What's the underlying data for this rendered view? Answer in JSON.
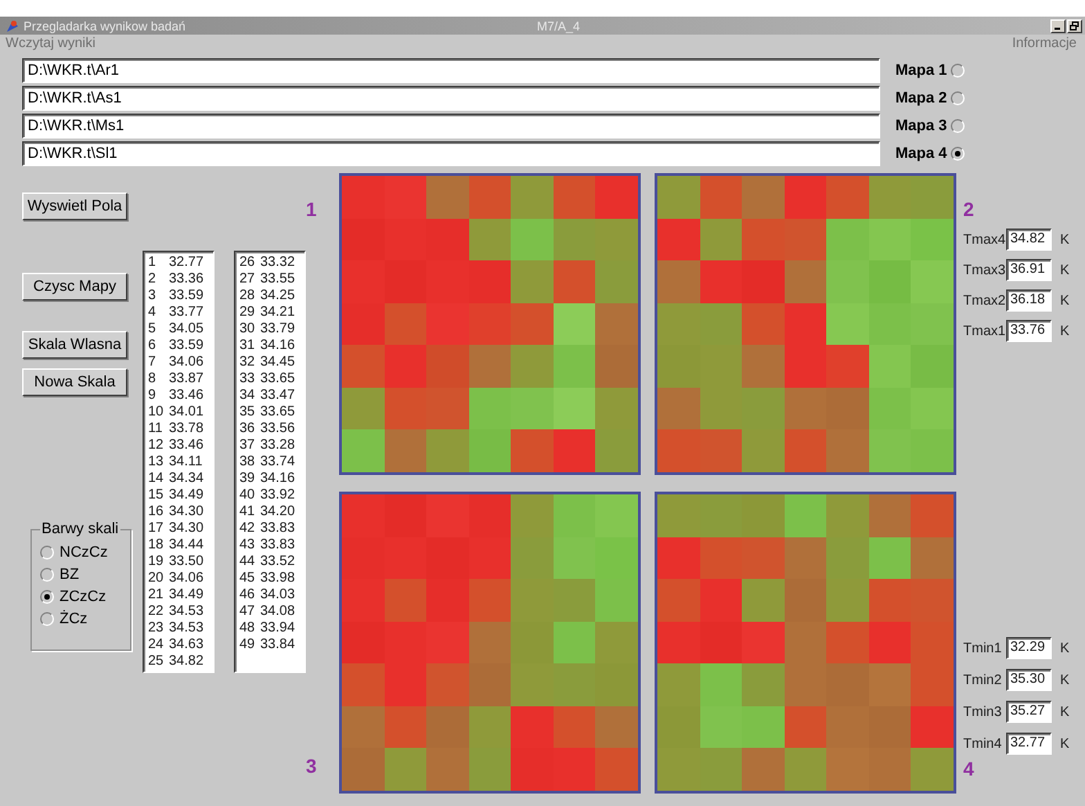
{
  "window": {
    "title": "Przegladarka wynikow badań",
    "subtitle": "M7/A_4"
  },
  "menu": [
    {
      "label": "Wczytaj wyniki",
      "disabled": true
    },
    {
      "label": "Informacje",
      "disabled": true
    }
  ],
  "files": [
    {
      "path": "D:\\WKR.t\\Ar1",
      "map_label": "Mapa 1",
      "selected": false
    },
    {
      "path": "D:\\WKR.t\\As1",
      "map_label": "Mapa 2",
      "selected": false
    },
    {
      "path": "D:\\WKR.t\\Ms1",
      "map_label": "Mapa 3",
      "selected": false
    },
    {
      "path": "D:\\WKR.t\\Sl1",
      "map_label": "Mapa 4",
      "selected": true
    }
  ],
  "buttons": [
    "Wyswietl Pola",
    "Czysc Mapy",
    "Skala Wlasna",
    "Nowa Skala"
  ],
  "color_scale": {
    "title": "Barwy skali",
    "options": [
      {
        "label": "NCzCz",
        "selected": false
      },
      {
        "label": "BZ",
        "selected": false
      },
      {
        "label": "ZCzCz",
        "selected": true
      },
      {
        "label": "ŻCz",
        "selected": false
      }
    ]
  },
  "value_lists": [
    [
      {
        "index": "1",
        "value": "32.77"
      },
      {
        "index": "2",
        "value": "33.36"
      },
      {
        "index": "3",
        "value": "33.59"
      },
      {
        "index": "4",
        "value": "33.77"
      },
      {
        "index": "5",
        "value": "34.05"
      },
      {
        "index": "6",
        "value": "33.59"
      },
      {
        "index": "7",
        "value": "34.06"
      },
      {
        "index": "8",
        "value": "33.87"
      },
      {
        "index": "9",
        "value": "33.46"
      },
      {
        "index": "10",
        "value": "34.01"
      },
      {
        "index": "11",
        "value": "33.78"
      },
      {
        "index": "12",
        "value": "33.46"
      },
      {
        "index": "13",
        "value": "34.11"
      },
      {
        "index": "14",
        "value": "34.34"
      },
      {
        "index": "15",
        "value": "34.49"
      },
      {
        "index": "16",
        "value": "34.30"
      },
      {
        "index": "17",
        "value": "34.30"
      },
      {
        "index": "18",
        "value": "34.44"
      },
      {
        "index": "19",
        "value": "33.50"
      },
      {
        "index": "20",
        "value": "34.06"
      },
      {
        "index": "21",
        "value": "34.49"
      },
      {
        "index": "22",
        "value": "34.53"
      },
      {
        "index": "23",
        "value": "34.53"
      },
      {
        "index": "24",
        "value": "34.63"
      },
      {
        "index": "25",
        "value": "34.82"
      }
    ],
    [
      {
        "index": "26",
        "value": "33.32"
      },
      {
        "index": "27",
        "value": "33.55"
      },
      {
        "index": "28",
        "value": "34.25"
      },
      {
        "index": "29",
        "value": "34.21"
      },
      {
        "index": "30",
        "value": "33.79"
      },
      {
        "index": "31",
        "value": "34.16"
      },
      {
        "index": "32",
        "value": "34.45"
      },
      {
        "index": "33",
        "value": "33.65"
      },
      {
        "index": "34",
        "value": "33.47"
      },
      {
        "index": "35",
        "value": "33.65"
      },
      {
        "index": "36",
        "value": "33.56"
      },
      {
        "index": "37",
        "value": "33.28"
      },
      {
        "index": "38",
        "value": "33.74"
      },
      {
        "index": "39",
        "value": "34.16"
      },
      {
        "index": "40",
        "value": "33.92"
      },
      {
        "index": "41",
        "value": "34.20"
      },
      {
        "index": "42",
        "value": "33.83"
      },
      {
        "index": "43",
        "value": "33.83"
      },
      {
        "index": "44",
        "value": "33.52"
      },
      {
        "index": "45",
        "value": "33.98"
      },
      {
        "index": "46",
        "value": "34.03"
      },
      {
        "index": "47",
        "value": "34.08"
      },
      {
        "index": "48",
        "value": "33.94"
      },
      {
        "index": "49",
        "value": "33.84"
      }
    ]
  ],
  "maps": [
    {
      "number": "1",
      "rows": [
        {
          "cells": [
            {
              "color": "#e8302c"
            },
            {
              "color": "#ea3430"
            },
            {
              "color": "#b0703a"
            },
            {
              "color": "#d4502c"
            },
            {
              "color": "#8f9a3a"
            },
            {
              "color": "#d4502c"
            },
            {
              "color": "#e8302c"
            }
          ]
        },
        {
          "cells": [
            {
              "color": "#e42c28"
            },
            {
              "color": "#e8302c"
            },
            {
              "color": "#e62e2a"
            },
            {
              "color": "#8f9a3a"
            },
            {
              "color": "#7cc04a"
            },
            {
              "color": "#8a9c3c"
            },
            {
              "color": "#8f9a3a"
            }
          ]
        },
        {
          "cells": [
            {
              "color": "#e8302c"
            },
            {
              "color": "#e42c28"
            },
            {
              "color": "#e8302c"
            },
            {
              "color": "#e62e2a"
            },
            {
              "color": "#8f9a3a"
            },
            {
              "color": "#d4502c"
            },
            {
              "color": "#8a9c3c"
            }
          ]
        },
        {
          "cells": [
            {
              "color": "#e62e2a"
            },
            {
              "color": "#d4502c"
            },
            {
              "color": "#ea3430"
            },
            {
              "color": "#e0402c"
            },
            {
              "color": "#d4502c"
            },
            {
              "color": "#8ccc58"
            },
            {
              "color": "#b0703a"
            }
          ]
        },
        {
          "cells": [
            {
              "color": "#d4502c"
            },
            {
              "color": "#e8302c"
            },
            {
              "color": "#d04c2a"
            },
            {
              "color": "#b0703a"
            },
            {
              "color": "#8f9a3a"
            },
            {
              "color": "#7cc04a"
            },
            {
              "color": "#ac6c38"
            }
          ]
        },
        {
          "cells": [
            {
              "color": "#8f9a3a"
            },
            {
              "color": "#d4502c"
            },
            {
              "color": "#d0542e"
            },
            {
              "color": "#7cc04a"
            },
            {
              "color": "#80c24e"
            },
            {
              "color": "#8ccc58"
            },
            {
              "color": "#8f9a3a"
            }
          ]
        },
        {
          "cells": [
            {
              "color": "#7cc04a"
            },
            {
              "color": "#b0703a"
            },
            {
              "color": "#8f9a3a"
            },
            {
              "color": "#78bc46"
            },
            {
              "color": "#d4502c"
            },
            {
              "color": "#e8302c"
            },
            {
              "color": "#8a9c3c"
            }
          ]
        }
      ]
    },
    {
      "number": "2",
      "rows": [
        {
          "cells": [
            {
              "color": "#8f9a3a"
            },
            {
              "color": "#d4502c"
            },
            {
              "color": "#b0703a"
            },
            {
              "color": "#e8302c"
            },
            {
              "color": "#d4502c"
            },
            {
              "color": "#8f9a3a"
            },
            {
              "color": "#8a9c3c"
            }
          ]
        },
        {
          "cells": [
            {
              "color": "#e8302c"
            },
            {
              "color": "#8f9a3a"
            },
            {
              "color": "#d4502c"
            },
            {
              "color": "#d0542e"
            },
            {
              "color": "#7cc04a"
            },
            {
              "color": "#84c650"
            },
            {
              "color": "#7ac248"
            }
          ]
        },
        {
          "cells": [
            {
              "color": "#b0703a"
            },
            {
              "color": "#e8302c"
            },
            {
              "color": "#e42c28"
            },
            {
              "color": "#b0703a"
            },
            {
              "color": "#80c24e"
            },
            {
              "color": "#76bc44"
            },
            {
              "color": "#86c852"
            }
          ]
        },
        {
          "cells": [
            {
              "color": "#8f9a3a"
            },
            {
              "color": "#8a9c3c"
            },
            {
              "color": "#d4502c"
            },
            {
              "color": "#e8302c"
            },
            {
              "color": "#86c852"
            },
            {
              "color": "#7cc04a"
            },
            {
              "color": "#80c24e"
            }
          ]
        },
        {
          "cells": [
            {
              "color": "#8c9838"
            },
            {
              "color": "#8f9a3a"
            },
            {
              "color": "#b0703a"
            },
            {
              "color": "#e8302c"
            },
            {
              "color": "#e0402c"
            },
            {
              "color": "#84c650"
            },
            {
              "color": "#78bc46"
            }
          ]
        },
        {
          "cells": [
            {
              "color": "#b0703a"
            },
            {
              "color": "#8f9a3a"
            },
            {
              "color": "#8a9c3c"
            },
            {
              "color": "#b0703a"
            },
            {
              "color": "#ac6c38"
            },
            {
              "color": "#7cc04a"
            },
            {
              "color": "#84c650"
            }
          ]
        },
        {
          "cells": [
            {
              "color": "#d4502c"
            },
            {
              "color": "#d0542e"
            },
            {
              "color": "#8f9a3a"
            },
            {
              "color": "#d4502c"
            },
            {
              "color": "#b0703a"
            },
            {
              "color": "#80c24e"
            },
            {
              "color": "#7cc04a"
            }
          ]
        }
      ]
    },
    {
      "number": "3",
      "rows": [
        {
          "cells": [
            {
              "color": "#e8302c"
            },
            {
              "color": "#e42c28"
            },
            {
              "color": "#ea3430"
            },
            {
              "color": "#e62e2a"
            },
            {
              "color": "#8f9a3a"
            },
            {
              "color": "#7cc04a"
            },
            {
              "color": "#84c650"
            }
          ]
        },
        {
          "cells": [
            {
              "color": "#e62e2a"
            },
            {
              "color": "#e8302c"
            },
            {
              "color": "#e42c28"
            },
            {
              "color": "#e8302c"
            },
            {
              "color": "#8a9c3c"
            },
            {
              "color": "#80c24e"
            },
            {
              "color": "#7ac248"
            }
          ]
        },
        {
          "cells": [
            {
              "color": "#e8302c"
            },
            {
              "color": "#d4502c"
            },
            {
              "color": "#e62e2a"
            },
            {
              "color": "#d4502c"
            },
            {
              "color": "#8f9a3a"
            },
            {
              "color": "#8a9c3c"
            },
            {
              "color": "#7cc04a"
            }
          ]
        },
        {
          "cells": [
            {
              "color": "#e42c28"
            },
            {
              "color": "#e8302c"
            },
            {
              "color": "#ea3430"
            },
            {
              "color": "#b0703a"
            },
            {
              "color": "#8c9838"
            },
            {
              "color": "#7cc04a"
            },
            {
              "color": "#8f9a3a"
            }
          ]
        },
        {
          "cells": [
            {
              "color": "#d4502c"
            },
            {
              "color": "#e8302c"
            },
            {
              "color": "#d0542e"
            },
            {
              "color": "#ac6c38"
            },
            {
              "color": "#8f9a3a"
            },
            {
              "color": "#8a9c3c"
            },
            {
              "color": "#8c9838"
            }
          ]
        },
        {
          "cells": [
            {
              "color": "#b0703a"
            },
            {
              "color": "#d4502c"
            },
            {
              "color": "#ac6c38"
            },
            {
              "color": "#8f9a3a"
            },
            {
              "color": "#e8302c"
            },
            {
              "color": "#d4502c"
            },
            {
              "color": "#b0703a"
            }
          ]
        },
        {
          "cells": [
            {
              "color": "#ac6c38"
            },
            {
              "color": "#8f9a3a"
            },
            {
              "color": "#b0703a"
            },
            {
              "color": "#8a9c3c"
            },
            {
              "color": "#e62e2a"
            },
            {
              "color": "#e8302c"
            },
            {
              "color": "#d4502c"
            }
          ]
        }
      ]
    },
    {
      "number": "4",
      "rows": [
        {
          "cells": [
            {
              "color": "#8f9a3a"
            },
            {
              "color": "#8a9c3c"
            },
            {
              "color": "#8c9838"
            },
            {
              "color": "#7cc04a"
            },
            {
              "color": "#8f9a3a"
            },
            {
              "color": "#b0703a"
            },
            {
              "color": "#d4502c"
            }
          ]
        },
        {
          "cells": [
            {
              "color": "#e8302c"
            },
            {
              "color": "#d4502c"
            },
            {
              "color": "#d0542e"
            },
            {
              "color": "#b0703a"
            },
            {
              "color": "#8a9c3c"
            },
            {
              "color": "#7cc04a"
            },
            {
              "color": "#b0703a"
            }
          ]
        },
        {
          "cells": [
            {
              "color": "#d4502c"
            },
            {
              "color": "#e8302c"
            },
            {
              "color": "#8f9a3a"
            },
            {
              "color": "#ac6c38"
            },
            {
              "color": "#8f9a3a"
            },
            {
              "color": "#d4502c"
            },
            {
              "color": "#d0542e"
            }
          ]
        },
        {
          "cells": [
            {
              "color": "#e8302c"
            },
            {
              "color": "#e42c28"
            },
            {
              "color": "#ea3430"
            },
            {
              "color": "#b0703a"
            },
            {
              "color": "#d4502c"
            },
            {
              "color": "#e8302c"
            },
            {
              "color": "#d4502c"
            }
          ]
        },
        {
          "cells": [
            {
              "color": "#8f9a3a"
            },
            {
              "color": "#7cc04a"
            },
            {
              "color": "#8a9c3c"
            },
            {
              "color": "#b0703a"
            },
            {
              "color": "#ac6c38"
            },
            {
              "color": "#b4743c"
            },
            {
              "color": "#d4502c"
            }
          ]
        },
        {
          "cells": [
            {
              "color": "#8c9838"
            },
            {
              "color": "#80c24e"
            },
            {
              "color": "#7cc04a"
            },
            {
              "color": "#d4502c"
            },
            {
              "color": "#b0703a"
            },
            {
              "color": "#ac6c38"
            },
            {
              "color": "#e8302c"
            }
          ]
        },
        {
          "cells": [
            {
              "color": "#8f9a3a"
            },
            {
              "color": "#8a9c3c"
            },
            {
              "color": "#b0703a"
            },
            {
              "color": "#8f9a3a"
            },
            {
              "color": "#b4743c"
            },
            {
              "color": "#b0703a"
            },
            {
              "color": "#8f9a3a"
            }
          ]
        }
      ]
    }
  ],
  "tmax": [
    {
      "label": "Tmax4",
      "value": "34.82",
      "unit": "K"
    },
    {
      "label": "Tmax3",
      "value": "36.91",
      "unit": "K"
    },
    {
      "label": "Tmax2",
      "value": "36.18",
      "unit": "K"
    },
    {
      "label": "Tmax1",
      "value": "33.76",
      "unit": "K"
    }
  ],
  "tmin": [
    {
      "label": "Tmin1",
      "value": "32.29",
      "unit": "K"
    },
    {
      "label": "Tmin2",
      "value": "35.30",
      "unit": "K"
    },
    {
      "label": "Tmin3",
      "value": "35.27",
      "unit": "K"
    },
    {
      "label": "Tmin4",
      "value": "32.77",
      "unit": "K"
    }
  ]
}
